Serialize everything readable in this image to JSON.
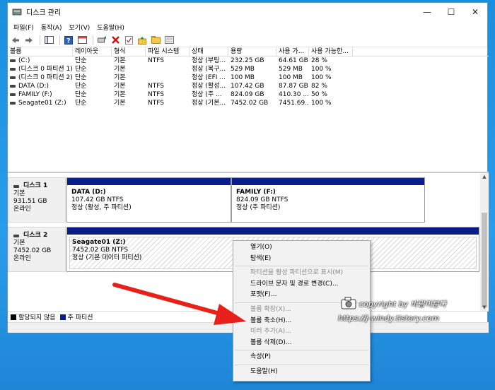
{
  "window": {
    "title": "디스크 관리",
    "controls": {
      "minimize": "—",
      "maximize": "☐",
      "close": "✕"
    }
  },
  "menu": [
    "파일(F)",
    "동작(A)",
    "보기(V)",
    "도움말(H)"
  ],
  "toolbar": [
    "back-icon",
    "forward-icon",
    "console-tree-icon",
    "help-icon",
    "properties-icon",
    "connect-icon",
    "delete-icon",
    "check-icon",
    "up-icon",
    "folder-icon",
    "list-icon"
  ],
  "volumes": {
    "headers": [
      "볼륨",
      "레이아웃",
      "형식",
      "파일 시스템",
      "상태",
      "용량",
      "사용 가...",
      "사용 가능한..."
    ],
    "rows": [
      [
        "(C:)",
        "단순",
        "기본",
        "NTFS",
        "정상 (부팅...",
        "232.25 GB",
        "64.61 GB",
        "28 %"
      ],
      [
        "(디스크 0 파티션 1)",
        "단순",
        "기본",
        "",
        "정상 (복구...",
        "529 MB",
        "529 MB",
        "100 %"
      ],
      [
        "(디스크 0 파티션 2)",
        "단순",
        "기본",
        "",
        "정상 (EFI ...",
        "100 MB",
        "100 MB",
        "100 %"
      ],
      [
        "DATA (D:)",
        "단순",
        "기본",
        "NTFS",
        "정상 (활성...",
        "107.42 GB",
        "87.87 GB",
        "82 %"
      ],
      [
        "FAMILY (F:)",
        "단순",
        "기본",
        "NTFS",
        "정상 (주 ...",
        "824.09 GB",
        "410.30 ...",
        "50 %"
      ],
      [
        "Seagate01 (Z:)",
        "단순",
        "기본",
        "NTFS",
        "정상 (기본...",
        "7452.02 GB",
        "7451.69...",
        "100 %"
      ]
    ]
  },
  "disks": [
    {
      "name": "디스크 1",
      "type": "기본",
      "size": "931.51 GB",
      "status": "온라인",
      "partitions": [
        {
          "name": "DATA  (D:)",
          "size": "107.42 GB NTFS",
          "status": "정상 (활성, 주 파티션)"
        },
        {
          "name": "FAMILY  (F:)",
          "size": "824.09 GB NTFS",
          "status": "정상 (주 파티션)"
        }
      ]
    },
    {
      "name": "디스크 2",
      "type": "기본",
      "size": "7452.02 GB",
      "status": "온라인",
      "partitions": [
        {
          "name": "Seagate01  (Z:)",
          "size": "7452.02 GB NTFS",
          "status": "정상 (기본 데이터 파티션)"
        }
      ]
    }
  ],
  "legend": [
    {
      "label": "할당되지 않음",
      "color": "#000000"
    },
    {
      "label": "주 파티션",
      "color": "#0a1d8a"
    }
  ],
  "context_menu": {
    "items": [
      {
        "label": "열기(O)",
        "enabled": true
      },
      {
        "label": "탐색(E)",
        "enabled": true
      },
      {
        "label": "파티션을 활성 파티션으로 표시(M)",
        "enabled": false
      },
      {
        "label": "드라이브 문자 및 경로 변경(C)...",
        "enabled": true
      },
      {
        "label": "포맷(F)...",
        "enabled": true
      },
      {
        "label": "볼륨 확장(X)...",
        "enabled": false
      },
      {
        "label": "볼륨 축소(H)...",
        "enabled": true
      },
      {
        "label": "미러 추가(A)...",
        "enabled": false
      },
      {
        "label": "볼륨 삭제(D)...",
        "enabled": true
      },
      {
        "label": "속성(P)",
        "enabled": true
      },
      {
        "label": "도움말(H)",
        "enabled": true
      }
    ]
  },
  "watermark": {
    "line1": "copyright by 바람이분다",
    "line2": "https://j-windy.tistory.com"
  },
  "colors": {
    "partition_bar": "#0a1d8a",
    "arrow": "#e8201a",
    "desktop": "#1f8fe0"
  }
}
